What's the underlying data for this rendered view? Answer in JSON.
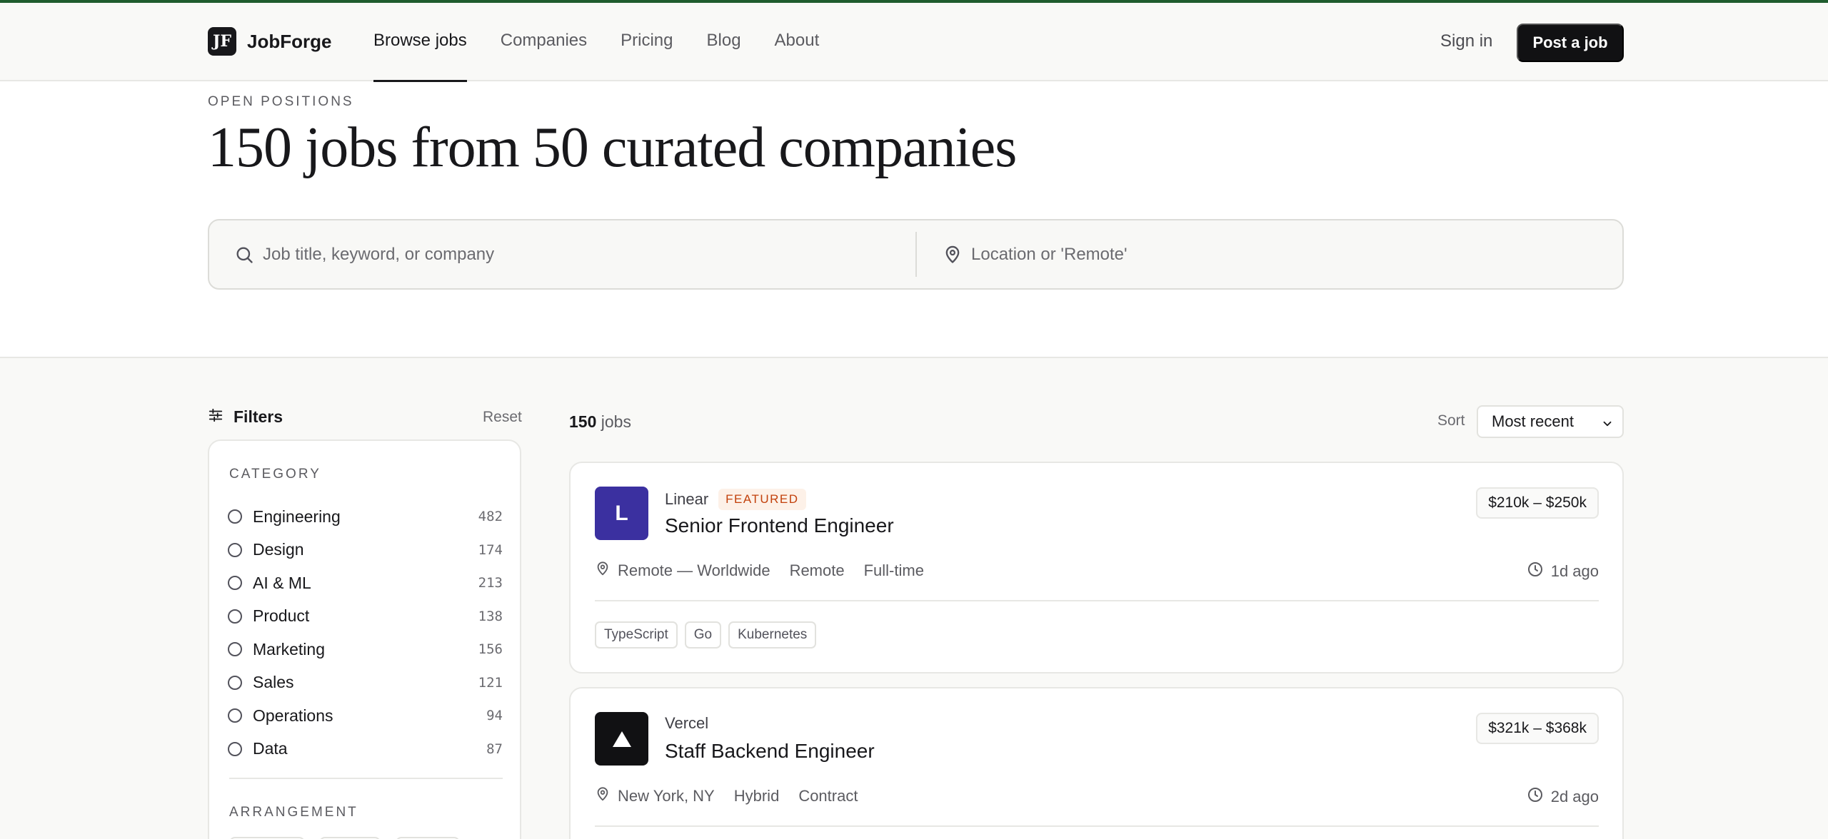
{
  "brand": {
    "name": "JobForge",
    "mark": "JF"
  },
  "nav": {
    "links": [
      {
        "label": "Browse jobs",
        "active": true
      },
      {
        "label": "Companies"
      },
      {
        "label": "Pricing"
      },
      {
        "label": "Blog"
      },
      {
        "label": "About"
      }
    ],
    "sign_in": "Sign in",
    "post_job": "Post a job"
  },
  "hero": {
    "eyebrow": "OPEN POSITIONS",
    "title": "150 jobs from 50 curated companies",
    "search_placeholder": "Job title, keyword, or company",
    "location_placeholder": "Location or 'Remote'"
  },
  "filters": {
    "title": "Filters",
    "reset": "Reset",
    "category_label": "CATEGORY",
    "categories": [
      {
        "label": "Engineering",
        "count": "482"
      },
      {
        "label": "Design",
        "count": "174"
      },
      {
        "label": "AI & ML",
        "count": "213"
      },
      {
        "label": "Product",
        "count": "138"
      },
      {
        "label": "Marketing",
        "count": "156"
      },
      {
        "label": "Sales",
        "count": "121"
      },
      {
        "label": "Operations",
        "count": "94"
      },
      {
        "label": "Data",
        "count": "87"
      }
    ],
    "arrangement_label": "ARRANGEMENT"
  },
  "results": {
    "count": "150",
    "count_suffix": "jobs",
    "sort_label": "Sort",
    "sort_value": "Most recent",
    "jobs": [
      {
        "company": "Linear",
        "logo_letter": "L",
        "logo_color": "#3b30a0",
        "featured": "FEATURED",
        "title": "Senior Frontend Engineer",
        "salary": "$210k – $250k",
        "location": "Remote — Worldwide",
        "arrangement": "Remote",
        "type": "Full-time",
        "posted": "1d ago",
        "tags": [
          "TypeScript",
          "Go",
          "Kubernetes"
        ]
      },
      {
        "company": "Vercel",
        "logo_color": "#111113",
        "title": "Staff Backend Engineer",
        "salary": "$321k – $368k",
        "location": "New York, NY",
        "arrangement": "Hybrid",
        "type": "Contract",
        "posted": "2d ago"
      }
    ]
  }
}
